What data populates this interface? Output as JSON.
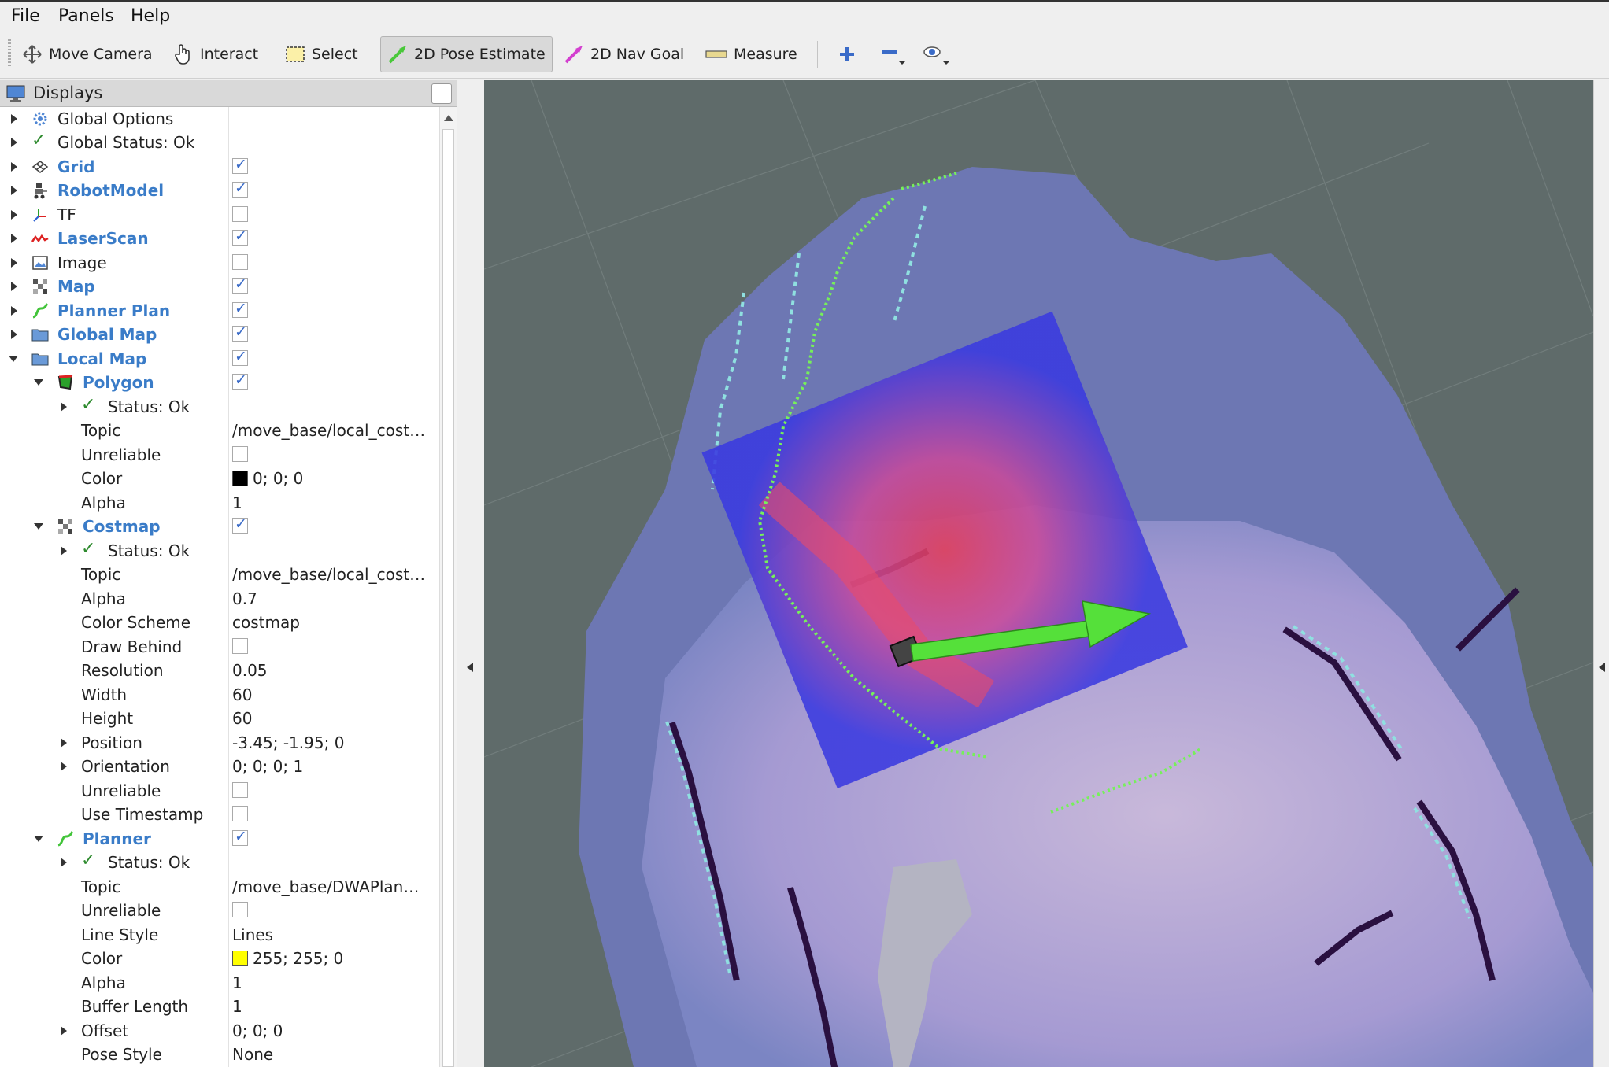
{
  "menu": {
    "file": "File",
    "panels": "Panels",
    "help": "Help"
  },
  "toolbar": {
    "move_camera": "Move Camera",
    "interact": "Interact",
    "select": "Select",
    "pose_estimate": "2D Pose Estimate",
    "nav_goal": "2D Nav Goal",
    "measure": "Measure"
  },
  "displays": {
    "title": "Displays",
    "items": {
      "global_options": "Global Options",
      "global_status": "Global Status: Ok",
      "grid": "Grid",
      "robot_model": "RobotModel",
      "tf": "TF",
      "laser_scan": "LaserScan",
      "image": "Image",
      "map": "Map",
      "planner_plan": "Planner Plan",
      "global_map": "Global Map",
      "local_map": "Local Map"
    },
    "polygon": {
      "label": "Polygon",
      "status": "Status: Ok",
      "topic_label": "Topic",
      "topic": "/move_base/local_cost…",
      "unreliable_label": "Unreliable",
      "color_label": "Color",
      "color": "0; 0; 0",
      "color_hex": "#000000",
      "alpha_label": "Alpha",
      "alpha": "1"
    },
    "costmap": {
      "label": "Costmap",
      "status": "Status: Ok",
      "topic_label": "Topic",
      "topic": "/move_base/local_cost…",
      "alpha_label": "Alpha",
      "alpha": "0.7",
      "color_scheme_label": "Color Scheme",
      "color_scheme": "costmap",
      "draw_behind_label": "Draw Behind",
      "resolution_label": "Resolution",
      "resolution": "0.05",
      "width_label": "Width",
      "width": "60",
      "height_label": "Height",
      "height": "60",
      "position_label": "Position",
      "position": "-3.45; -1.95; 0",
      "orientation_label": "Orientation",
      "orientation": "0; 0; 0; 1",
      "unreliable_label": "Unreliable",
      "use_timestamp_label": "Use Timestamp"
    },
    "planner": {
      "label": "Planner",
      "status": "Status: Ok",
      "topic_label": "Topic",
      "topic": "/move_base/DWAPlan…",
      "unreliable_label": "Unreliable",
      "line_style_label": "Line Style",
      "line_style": "Lines",
      "color_label": "Color",
      "color": "255; 255; 0",
      "color_hex": "#ffff00",
      "alpha_label": "Alpha",
      "alpha": "1",
      "buffer_length_label": "Buffer Length",
      "buffer_length": "1",
      "offset_label": "Offset",
      "offset": "0; 0; 0",
      "pose_style_label": "Pose Style",
      "pose_style": "None"
    }
  },
  "checks": {
    "grid": true,
    "robot_model": true,
    "tf": false,
    "laser_scan": true,
    "image": false,
    "map": true,
    "planner_plan": true,
    "global_map": true,
    "local_map": true,
    "polygon": true,
    "polygon_unreliable": false,
    "costmap": true,
    "costmap_draw_behind": false,
    "costmap_unreliable": false,
    "costmap_use_timestamp": false,
    "planner": true,
    "planner_unreliable": false
  },
  "colors": {
    "accent_label": "#3a7cc8",
    "viewport_bg": "#5f6b6a",
    "goal_arrow": "#55e03a"
  }
}
